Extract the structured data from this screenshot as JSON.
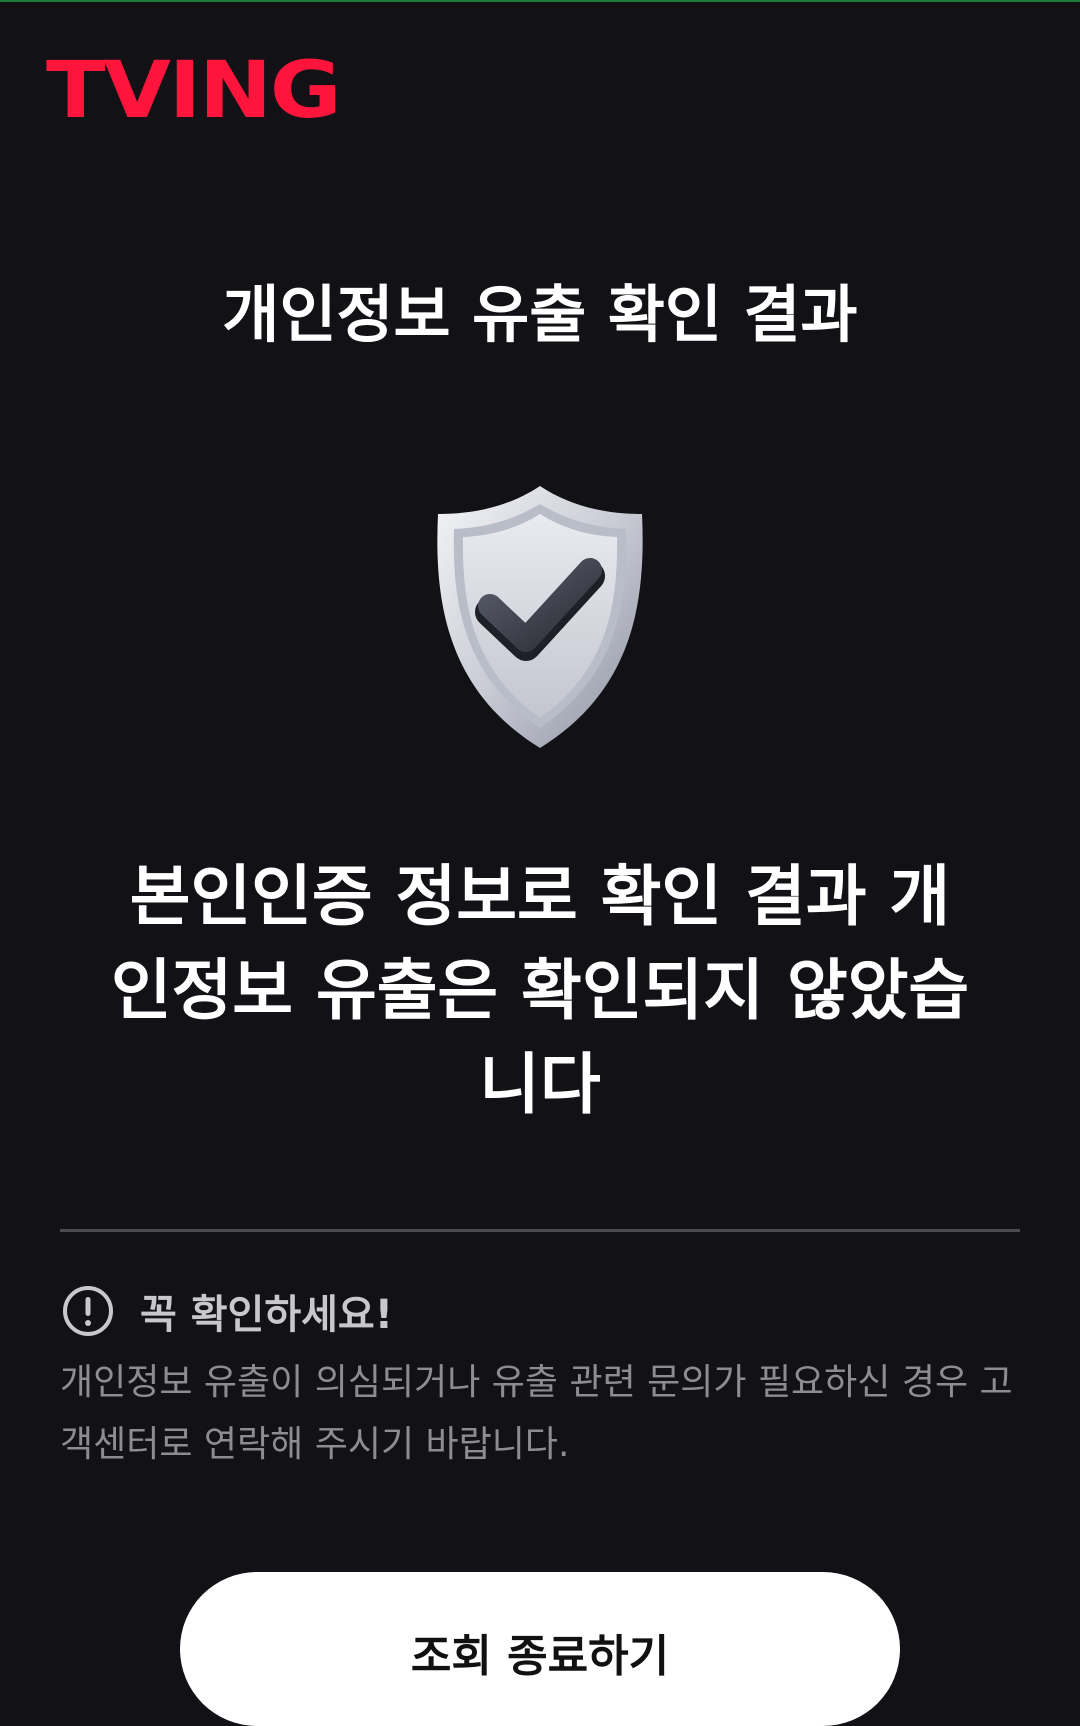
{
  "brand": {
    "logo_text": "TVING",
    "accent_color": "#ff153c"
  },
  "page": {
    "title": "개인정보 유출 확인 결과",
    "shield_icon": "shield-check-icon",
    "result_message": "본인인증 정보로 확인 결과 개인정보 유출은 확인되지 않았습니다"
  },
  "notice": {
    "icon": "exclamation-circle-icon",
    "title": "꼭 확인하세요!",
    "body": "개인정보 유출이 의심되거나 유출 관련 문의가 필요하신 경우 고객센터로 연락해 주시기 바랍니다."
  },
  "actions": {
    "end_label": "조회 종료하기"
  },
  "colors": {
    "background": "#121115",
    "button_bg": "#ffffff"
  }
}
